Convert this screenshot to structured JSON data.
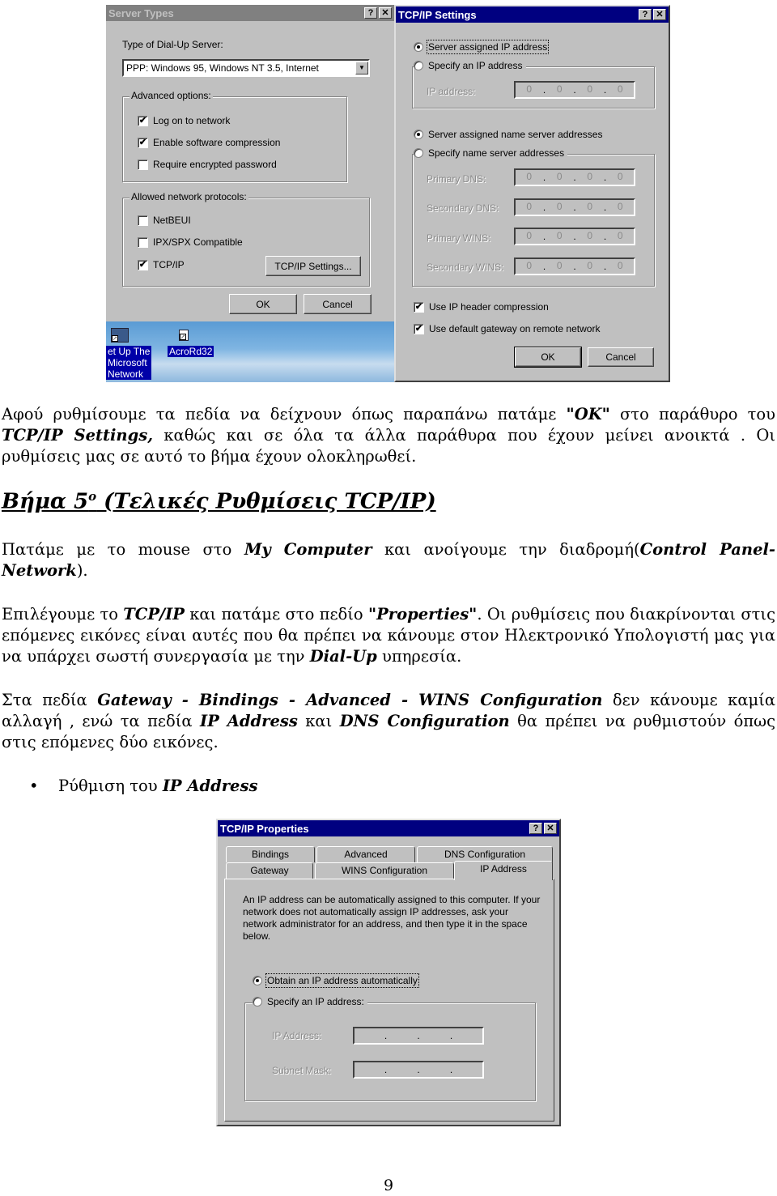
{
  "screenshot_top": {
    "server_types": {
      "title": "Server Types",
      "help_btn": "?",
      "close_btn": "✕",
      "dialup_label": "Type of Dial-Up Server:",
      "dialup_value": "PPP: Windows 95, Windows NT 3.5, Internet",
      "advanced_group": "Advanced options:",
      "options": [
        {
          "label": "Log on to network",
          "checked": true
        },
        {
          "label": "Enable software compression",
          "checked": true
        },
        {
          "label": "Require encrypted password",
          "checked": false
        }
      ],
      "protocols_group": "Allowed network protocols:",
      "protocols": [
        {
          "label": "NetBEUI",
          "checked": false
        },
        {
          "label": "IPX/SPX Compatible",
          "checked": false
        },
        {
          "label": "TCP/IP",
          "checked": true
        }
      ],
      "tcpip_settings_btn": "TCP/IP Settings...",
      "ok_btn": "OK",
      "cancel_btn": "Cancel"
    },
    "desktop": {
      "icons": [
        {
          "label": "et Up The\nMicrosoft\nNetwork"
        },
        {
          "label": "AcroRd32"
        }
      ]
    },
    "tcpip_settings": {
      "title": "TCP/IP Settings",
      "help_btn": "?",
      "close_btn": "✕",
      "radio_server_ip": "Server assigned IP address",
      "radio_specify_ip": "Specify an IP address",
      "ip_address_label": "IP address:",
      "radio_server_ns": "Server assigned name server addresses",
      "radio_specify_ns": "Specify name server addresses",
      "fields": [
        {
          "label": "Primary DNS:",
          "value": [
            "0",
            "0",
            "0",
            "0"
          ]
        },
        {
          "label": "Secondary DNS:",
          "value": [
            "0",
            "0",
            "0",
            "0"
          ]
        },
        {
          "label": "Primary WINS:",
          "value": [
            "0",
            "0",
            "0",
            "0"
          ]
        },
        {
          "label": "Secondary WINS:",
          "value": [
            "0",
            "0",
            "0",
            "0"
          ]
        }
      ],
      "ip_value": [
        "0",
        "0",
        "0",
        "0"
      ],
      "check_header_compression": "Use IP header compression",
      "check_default_gateway": "Use default gateway on remote network",
      "ok_btn": "OK",
      "cancel_btn": "Cancel"
    }
  },
  "text": {
    "p1_a": "Αφού ρυθμίσουμε τα πεδία να δείχνουν όπως παραπάνω πατάμε ",
    "p1_ok": "\"OK\"",
    "p1_b": " στο παράθυρο του ",
    "p1_tcpip": "TCP/IP Settings,",
    "p1_c": " καθώς και σε όλα τα άλλα παράθυρα που έχουν μείνει ανοικτά . Οι ρυθμίσεις μας σε αυτό το βήμα έχουν ολοκληρωθεί.",
    "heading_a": "Βήμα 5",
    "heading_sup": "ο",
    "heading_b": " (Τελικές Ρυθμίσεις TCP/IP)",
    "p2_a": "Πατάμε με το mouse στο ",
    "p2_mycomp": "My Computer",
    "p2_b": " και ανοίγουμε την διαδρομή(",
    "p2_path": "Control Panel-Network",
    "p2_c": ").",
    "p3_a": "Επιλέγουμε το ",
    "p3_tcpip": "TCP/IP",
    "p3_b": " και πατάμε στο πεδίο ",
    "p3_props": "\"Properties\"",
    "p3_c": ". Οι ρυθμίσεις που διακρίνονται στις επόμενες εικόνες είναι αυτές που θα πρέπει να κάνουμε στον Ηλεκτρονικό Υπολογιστή μας για να υπάρχει σωστή συνεργασία με την ",
    "p3_dialup": "Dial-Up",
    "p3_d": " υπηρεσία.",
    "p4_a": "Στα πεδία ",
    "p4_fields": "Gateway - Bindings - Advanced - WINS Configuration",
    "p4_b": " δεν κάνουμε καμία αλλαγή , ενώ τα πεδία ",
    "p4_ip": "IP Address",
    "p4_c": " και ",
    "p4_dns": "DNS Configuration",
    "p4_d": " θα πρέπει να ρυθμιστούν όπως στις επόμενες δύο εικόνες.",
    "bullet_dot": "•",
    "bullet_a": "Ρύθμιση του ",
    "bullet_b": "IP Address",
    "page_number": "9"
  },
  "screenshot_bottom": {
    "title": "TCP/IP Properties",
    "help_btn": "?",
    "close_btn": "✕",
    "tabs_back": [
      "Bindings",
      "Advanced",
      "DNS Configuration"
    ],
    "tabs_front": [
      "Gateway",
      "WINS Configuration",
      "IP Address"
    ],
    "active_tab": "IP Address",
    "description": "An IP address can be automatically assigned to this computer. If your network does not automatically assign IP addresses, ask your network administrator for an address, and then type it in the space below.",
    "radio_obtain": "Obtain an IP address automatically",
    "radio_specify": "Specify an IP address:",
    "ip_address_label": "IP Address:",
    "subnet_mask_label": "Subnet Mask:"
  }
}
